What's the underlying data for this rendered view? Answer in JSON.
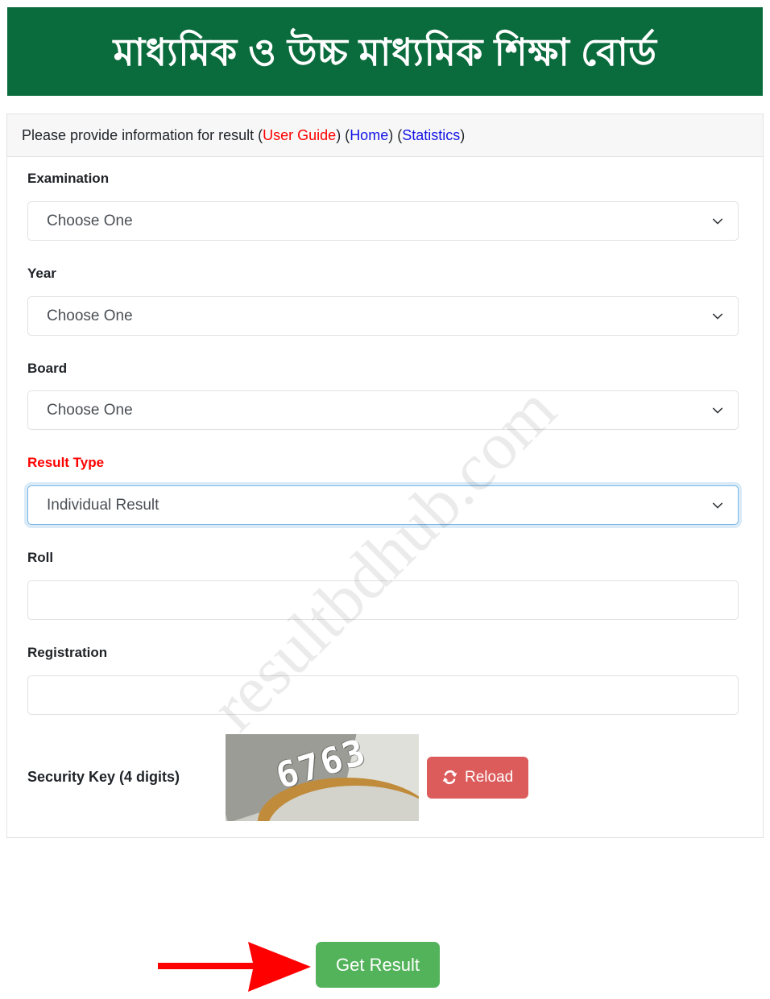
{
  "header": {
    "board_title_bn": "মাধ্যমিক ও উচ্চ মাধ্যমিক শিক্ষা বোর্ড",
    "background_color": "#0a6b3c",
    "text_color": "#ffffff"
  },
  "card": {
    "instruction_prefix": "Please provide information for result (",
    "user_guide_link": "User Guide",
    "between_1": ") (",
    "home_link": "Home",
    "between_2": ") (",
    "statistics_link": "Statistics",
    "suffix": ")",
    "user_guide_color": "#ff0000",
    "home_color": "#1414e6",
    "statistics_color": "#1414e6"
  },
  "form": {
    "examination": {
      "label": "Examination",
      "value": "Choose One",
      "caret_icon": "chevron-down-icon"
    },
    "year": {
      "label": "Year",
      "value": "Choose One",
      "caret_icon": "chevron-down-icon"
    },
    "board": {
      "label": "Board",
      "value": "Choose One",
      "caret_icon": "chevron-down-icon"
    },
    "result_type": {
      "label": "Result Type",
      "label_color": "#ff0000",
      "value": "Individual Result",
      "caret_icon": "chevron-down-icon",
      "focused": true
    },
    "roll": {
      "label": "Roll",
      "value": "",
      "placeholder": ""
    },
    "registration": {
      "label": "Registration",
      "value": "",
      "placeholder": ""
    },
    "security_key": {
      "label": "Security Key (4 digits)",
      "captcha_code": "6763",
      "reload_label": "Reload",
      "reload_icon": "sync-icon",
      "reload_color": "#dc5b5b"
    }
  },
  "actions": {
    "submit_label": "Get Result",
    "submit_color": "#53b35a",
    "arrow_color": "#ff0000",
    "arrow_icon": "right-arrow-annotation-icon"
  },
  "watermark": {
    "text": "resultbdhub.com"
  }
}
